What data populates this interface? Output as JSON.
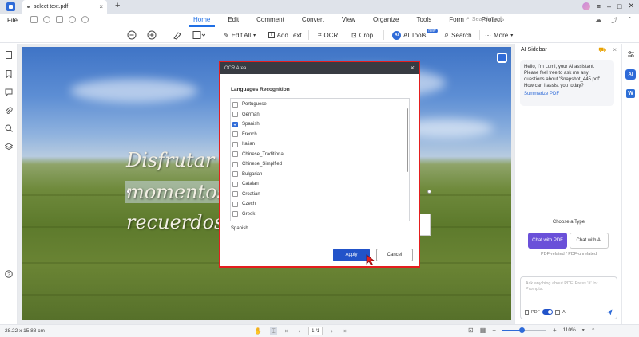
{
  "titlebar": {
    "tab_title": "select text.pdf",
    "new_tab": "+"
  },
  "menubar": {
    "file": "File",
    "tabs": [
      "Home",
      "Edit",
      "Comment",
      "Convert",
      "View",
      "Organize",
      "Tools",
      "Form",
      "Protect"
    ],
    "active_tab": "Home",
    "search_placeholder": "Search Tools"
  },
  "toolbar": {
    "edit_all": "Edit All",
    "add_text": "Add Text",
    "ocr": "OCR",
    "crop": "Crop",
    "ai_tools": "AI Tools",
    "ai_badge": "new",
    "search": "Search",
    "more": "More"
  },
  "document": {
    "line1": "Disfrutar",
    "line2": "momentos",
    "line3": "recuerdos"
  },
  "ocr_dialog": {
    "title": "OCR Area",
    "section_title": "Languages Recognition",
    "languages": [
      {
        "name": "Portuguese",
        "checked": false
      },
      {
        "name": "German",
        "checked": false
      },
      {
        "name": "Spanish",
        "checked": true
      },
      {
        "name": "French",
        "checked": false
      },
      {
        "name": "Italian",
        "checked": false
      },
      {
        "name": "Chinese_Traditional",
        "checked": false
      },
      {
        "name": "Chinese_Simplfied",
        "checked": false
      },
      {
        "name": "Bulgarian",
        "checked": false
      },
      {
        "name": "Catalan",
        "checked": false
      },
      {
        "name": "Croatian",
        "checked": false
      },
      {
        "name": "Czech",
        "checked": false
      },
      {
        "name": "Greek",
        "checked": false
      },
      {
        "name": "Korean",
        "checked": false
      }
    ],
    "selected_summary": "Spanish",
    "apply_label": "Apply",
    "cancel_label": "Cancel"
  },
  "ai_sidebar": {
    "title": "AI Sidebar",
    "greeting": "Hello, I'm Lumi, your AI assistant. Please feel free to ask me any questions about 'Snapshot_445.pdf'. How can I assist you today?",
    "summarize": "Summarize PDF",
    "choose_type": "Choose a Type",
    "type_pdf": "Chat with PDF",
    "type_ai": "Chat with AI",
    "type_desc": "PDF-related / PDF-unrelated",
    "ask_placeholder": "Ask anything about PDF. Press '#' for Prompts.",
    "pdf_label": "PDF",
    "ai_label": "AI"
  },
  "statusbar": {
    "dimensions": "28.22 x 15.88 cm",
    "page_number": "1 /1",
    "zoom": "110%",
    "zoom_fraction": 0.45
  },
  "colors": {
    "accent": "#2f6bd8",
    "dialog_highlight": "#e41e1e",
    "chat_pdf": "#6a50d9"
  }
}
